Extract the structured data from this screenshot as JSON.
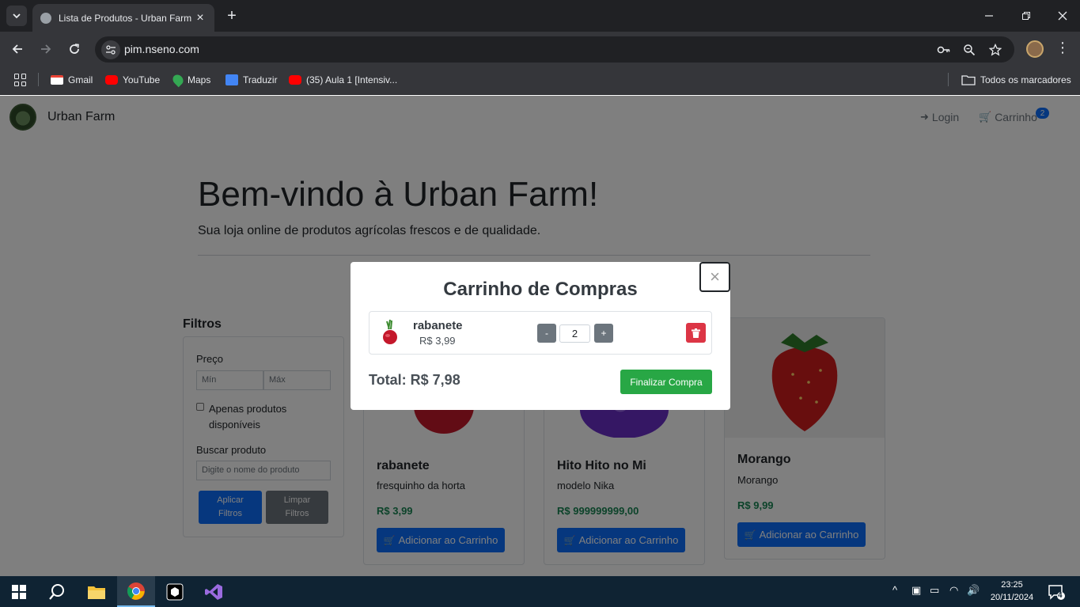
{
  "browser": {
    "tab_title": "Lista de Produtos - Urban Farm",
    "url": "pim.nseno.com",
    "bookmarks": [
      {
        "label": "Gmail",
        "icon": "gmail-icon"
      },
      {
        "label": "YouTube",
        "icon": "youtube-icon"
      },
      {
        "label": "Maps",
        "icon": "maps-icon"
      },
      {
        "label": "Traduzir",
        "icon": "translate-icon"
      },
      {
        "label": "(35) Aula 1 [Intensiv...",
        "icon": "youtube-icon"
      }
    ],
    "all_bookmarks": "Todos os marcadores"
  },
  "site": {
    "brand": "Urban Farm",
    "nav": {
      "login": "Login",
      "cart": "Carrinho",
      "cart_count": "2"
    },
    "hero": {
      "title": "Bem-vindo à Urban Farm!",
      "subtitle": "Sua loja online de produtos agrícolas frescos e de qualidade."
    },
    "filters": {
      "title": "Filtros",
      "price_label": "Preço",
      "min_placeholder": "Mín",
      "max_placeholder": "Máx",
      "available_label_1": "Apenas produtos",
      "available_label_2": "disponíveis",
      "search_label": "Buscar produto",
      "search_placeholder": "Digite o nome do produto",
      "apply_1": "Aplicar",
      "apply_2": "Filtros",
      "clear_1": "Limpar",
      "clear_2": "Filtros"
    },
    "products": [
      {
        "name": "rabanete",
        "description": "fresquinho da horta",
        "price": "R$ 3,99",
        "button": "Adicionar ao Carrinho"
      },
      {
        "name": "Hito Hito no Mi",
        "description": "modelo Nika",
        "price": "R$ 999999999,00",
        "button": "Adicionar ao Carrinho"
      },
      {
        "name": "Morango",
        "description": "Morango",
        "price": "R$ 9,99",
        "button": "Adicionar ao Carrinho"
      }
    ]
  },
  "modal": {
    "title": "Carrinho de Compras",
    "close": "×",
    "items": [
      {
        "name": "rabanete",
        "price": "R$ 3,99",
        "quantity": "2",
        "minus": "-",
        "plus": "+"
      }
    ],
    "total": "Total: R$ 7,98",
    "checkout": "Finalizar Compra"
  },
  "taskbar": {
    "time": "23:25",
    "date": "20/11/2024",
    "notifications": "4"
  },
  "colors": {
    "primary": "#0d6efd",
    "success": "#28a745",
    "danger": "#dc3545",
    "secondary": "#6c757d"
  }
}
